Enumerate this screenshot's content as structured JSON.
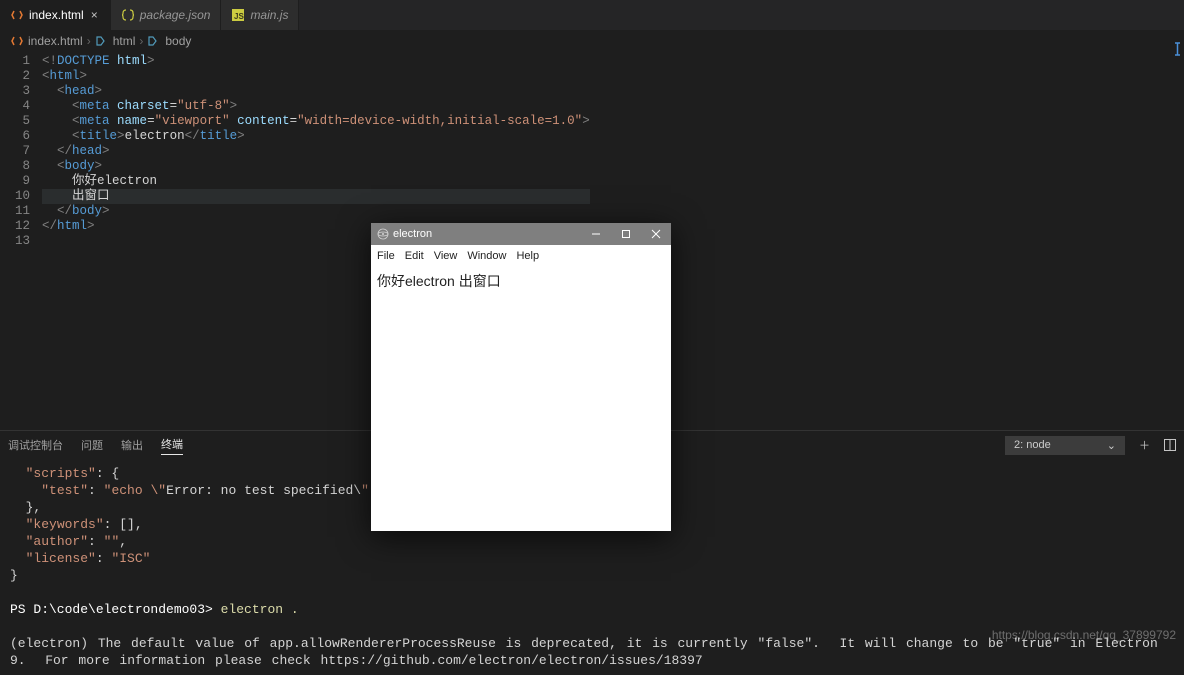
{
  "tabs": [
    {
      "label": "index.html",
      "active": true,
      "closable": true,
      "icon": "html"
    },
    {
      "label": "package.json",
      "active": false,
      "closable": false,
      "icon": "json"
    },
    {
      "label": "main.js",
      "active": false,
      "closable": false,
      "icon": "js"
    }
  ],
  "breadcrumb": {
    "parts": [
      "index.html",
      "html",
      "body"
    ],
    "sep": "›"
  },
  "editor": {
    "line_numbers": [
      "1",
      "2",
      "3",
      "4",
      "5",
      "6",
      "7",
      "8",
      "9",
      "10",
      "11",
      "12",
      "13"
    ],
    "highlighted_line": 10,
    "lines_tokens": [
      [
        [
          "tk-gray",
          "<!"
        ],
        [
          "tk-blue",
          "DOCTYPE "
        ],
        [
          "tk-lblue",
          "html"
        ],
        [
          "tk-gray",
          ">"
        ]
      ],
      [
        [
          "tk-gray",
          "<"
        ],
        [
          "tk-blue",
          "html"
        ],
        [
          "tk-gray",
          ">"
        ]
      ],
      [
        [
          "tk-text",
          "  "
        ],
        [
          "tk-gray",
          "<"
        ],
        [
          "tk-blue",
          "head"
        ],
        [
          "tk-gray",
          ">"
        ]
      ],
      [
        [
          "tk-text",
          "    "
        ],
        [
          "tk-gray",
          "<"
        ],
        [
          "tk-blue",
          "meta "
        ],
        [
          "tk-lblue",
          "charset"
        ],
        [
          "tk-text",
          "="
        ],
        [
          "tk-orange",
          "\"utf-8\""
        ],
        [
          "tk-gray",
          ">"
        ]
      ],
      [
        [
          "tk-text",
          "    "
        ],
        [
          "tk-gray",
          "<"
        ],
        [
          "tk-blue",
          "meta "
        ],
        [
          "tk-lblue",
          "name"
        ],
        [
          "tk-text",
          "="
        ],
        [
          "tk-orange",
          "\"viewport\""
        ],
        [
          "tk-text",
          " "
        ],
        [
          "tk-lblue",
          "content"
        ],
        [
          "tk-text",
          "="
        ],
        [
          "tk-orange",
          "\"width=device-width,initial-scale=1.0\""
        ],
        [
          "tk-gray",
          ">"
        ]
      ],
      [
        [
          "tk-text",
          "    "
        ],
        [
          "tk-gray",
          "<"
        ],
        [
          "tk-blue",
          "title"
        ],
        [
          "tk-gray",
          ">"
        ],
        [
          "tk-text",
          "electron"
        ],
        [
          "tk-gray",
          "</"
        ],
        [
          "tk-blue",
          "title"
        ],
        [
          "tk-gray",
          ">"
        ]
      ],
      [
        [
          "tk-text",
          "  "
        ],
        [
          "tk-gray",
          "</"
        ],
        [
          "tk-blue",
          "head"
        ],
        [
          "tk-gray",
          ">"
        ]
      ],
      [
        [
          "tk-text",
          "  "
        ],
        [
          "tk-gray",
          "<"
        ],
        [
          "tk-blue",
          "body"
        ],
        [
          "tk-gray",
          ">"
        ]
      ],
      [
        [
          "tk-text",
          "    你好electron"
        ]
      ],
      [
        [
          "tk-text",
          "    出窗口"
        ]
      ],
      [
        [
          "tk-text",
          "  "
        ],
        [
          "tk-gray",
          "</"
        ],
        [
          "tk-blue",
          "body"
        ],
        [
          "tk-gray",
          ">"
        ]
      ],
      [
        [
          "tk-gray",
          "</"
        ],
        [
          "tk-blue",
          "html"
        ],
        [
          "tk-gray",
          ">"
        ]
      ],
      [
        [
          "tk-text",
          ""
        ]
      ]
    ]
  },
  "panel": {
    "tabs": [
      "调试控制台",
      "问题",
      "输出",
      "终端"
    ],
    "active_tab": "终端",
    "dropdown": "2: node",
    "terminal_json": "  \"scripts\": {\n    \"test\": \"echo \\\"Error: no test specified\\\" && exit 1\"\n  },\n  \"keywords\": [],\n  \"author\": \"\",\n  \"license\": \"ISC\"\n}",
    "prompt_prefix": "PS D:\\code\\electrondemo03>",
    "prompt_cmd": "electron .",
    "message": "(electron) The default value of app.allowRendererProcessReuse is deprecated, it is currently \"false\".  It will change to be \"true\" in Electron 9.  For more information please check https://github.com/electron/electron/issues/18397"
  },
  "appwin": {
    "title": "electron",
    "menus": [
      "File",
      "Edit",
      "View",
      "Window",
      "Help"
    ],
    "content": "你好electron 出窗口"
  },
  "watermark": "https://blog.csdn.net/qq_37899792"
}
